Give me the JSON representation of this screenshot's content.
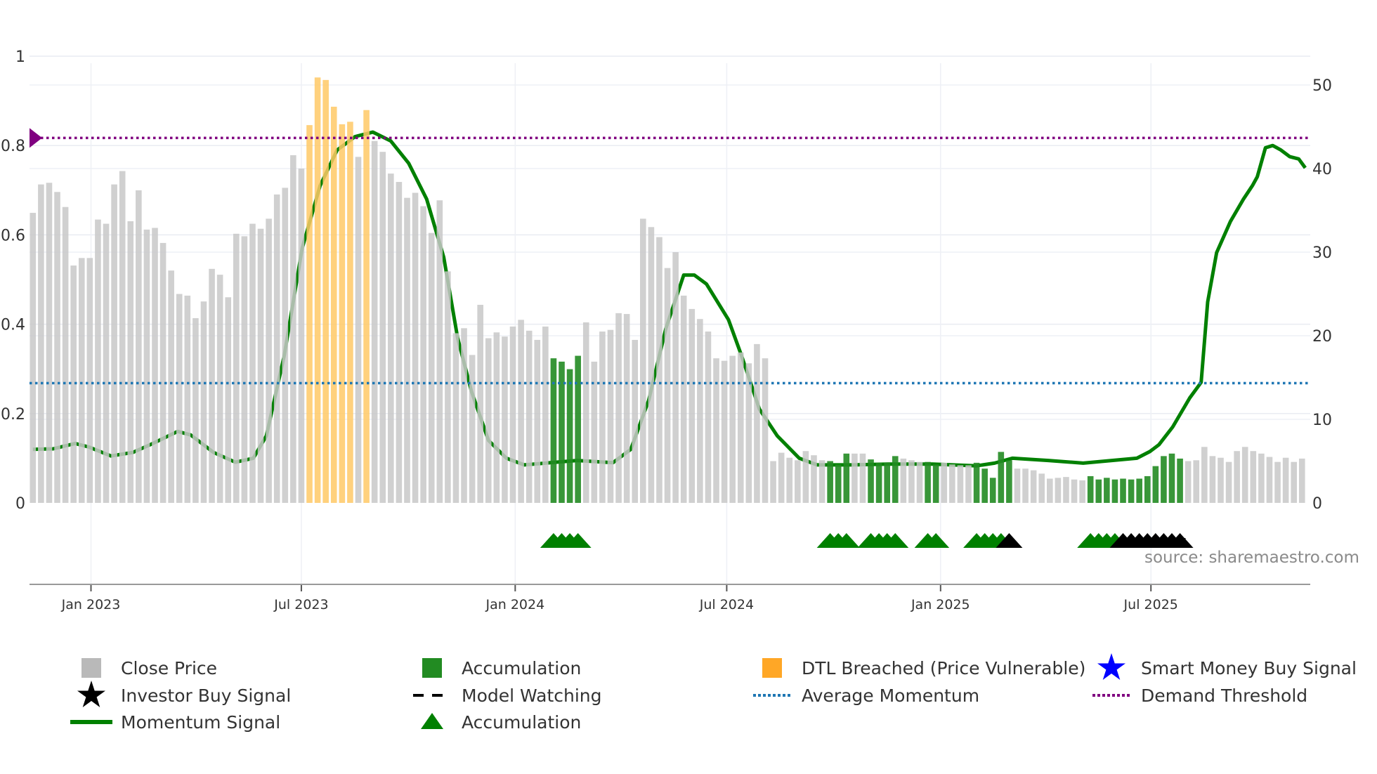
{
  "chart_data": {
    "type": "bar",
    "title": "",
    "start_date": "2022-11-12",
    "interval_days": 7,
    "left_axis": {
      "ylim": [
        0,
        1
      ],
      "ticks": [
        "0",
        "0.2",
        "0.4",
        "0.6",
        "0.8",
        "1"
      ]
    },
    "right_axis": {
      "ylim": [
        0,
        50
      ],
      "ticks": [
        "0",
        "10",
        "20",
        "30",
        "40",
        "50"
      ]
    },
    "x_ticks": [
      {
        "label": "Jan 2023",
        "date": "2023-01-01"
      },
      {
        "label": "Jul 2023",
        "date": "2023-07-01"
      },
      {
        "label": "Jan 2024",
        "date": "2024-01-01"
      },
      {
        "label": "Jul 2024",
        "date": "2024-07-01"
      },
      {
        "label": "Jan 2025",
        "date": "2025-01-01"
      },
      {
        "label": "Jul 2025",
        "date": "2025-07-01"
      }
    ],
    "close_price": [
      34.7,
      38.1,
      38.3,
      37.2,
      35.4,
      28.4,
      29.3,
      29.3,
      33.9,
      33.4,
      38.1,
      39.7,
      33.7,
      37.4,
      32.7,
      32.9,
      31.1,
      27.8,
      25.0,
      24.8,
      22.1,
      24.1,
      28.0,
      27.3,
      24.6,
      32.2,
      31.9,
      33.4,
      32.8,
      34.0,
      36.9,
      37.7,
      41.6,
      40.0,
      45.2,
      50.9,
      50.6,
      47.4,
      45.3,
      45.6,
      41.4,
      47.0,
      43.3,
      42.0,
      39.4,
      38.4,
      36.5,
      37.1,
      35.5,
      32.3,
      36.2,
      27.7,
      20.3,
      20.9,
      17.7,
      23.7,
      19.7,
      20.4,
      19.9,
      21.1,
      21.9,
      20.6,
      19.5,
      21.1,
      17.3,
      16.9,
      16.0,
      17.6,
      21.6,
      16.9,
      20.5,
      20.7,
      22.7,
      22.6,
      19.5,
      34.0,
      33.0,
      31.8,
      28.1,
      30.0,
      24.8,
      23.2,
      22.0,
      20.5,
      17.3,
      17.0,
      17.6,
      18.0,
      16.7,
      19.0,
      17.3,
      5.0,
      6.0,
      5.4,
      5.1,
      6.2,
      5.7,
      5.1,
      5.0,
      4.6,
      5.9,
      5.9,
      5.9,
      5.2,
      4.8,
      4.8,
      5.6,
      5.3,
      5.1,
      4.9,
      4.9,
      4.6,
      4.8,
      4.6,
      4.5,
      4.5,
      4.8,
      4.1,
      3.0,
      6.1,
      5.1,
      4.1,
      4.1,
      3.9,
      3.5,
      2.9,
      3.0,
      3.1,
      2.8,
      2.7,
      3.2,
      2.8,
      3.0,
      2.8,
      2.9,
      2.8,
      2.9,
      3.2,
      4.4,
      5.6,
      5.9,
      5.3,
      5.0,
      5.1,
      6.7,
      5.6,
      5.4,
      4.9,
      6.2,
      6.7,
      6.2,
      5.9,
      5.5,
      4.9,
      5.4,
      4.9,
      5.3
    ],
    "accumulation_bars": [
      64,
      65,
      66,
      67,
      98,
      99,
      100,
      103,
      104,
      105,
      106,
      110,
      111,
      116,
      117,
      118,
      119,
      120,
      130,
      131,
      132,
      133,
      134,
      135,
      136,
      137,
      138,
      139,
      140,
      141
    ],
    "dtl_breached_bars": [
      34,
      35,
      36,
      37,
      38,
      39,
      41
    ],
    "momentum_signal": [
      [
        0,
        0.12
      ],
      [
        2.5,
        0.121
      ],
      [
        5.2,
        0.133
      ],
      [
        6.9,
        0.125
      ],
      [
        9.6,
        0.105
      ],
      [
        12.3,
        0.113
      ],
      [
        14.5,
        0.131
      ],
      [
        17.8,
        0.16
      ],
      [
        19.4,
        0.152
      ],
      [
        22.2,
        0.113
      ],
      [
        24.9,
        0.091
      ],
      [
        27.1,
        0.1
      ],
      [
        28.7,
        0.15
      ],
      [
        30.9,
        0.33
      ],
      [
        33.1,
        0.57
      ],
      [
        35.3,
        0.71
      ],
      [
        37.4,
        0.79
      ],
      [
        39.6,
        0.82
      ],
      [
        41.8,
        0.83
      ],
      [
        44.0,
        0.81
      ],
      [
        46.2,
        0.76
      ],
      [
        48.4,
        0.68
      ],
      [
        50.5,
        0.55
      ],
      [
        52.2,
        0.37
      ],
      [
        53.9,
        0.25
      ],
      [
        56.0,
        0.14
      ],
      [
        58.2,
        0.1
      ],
      [
        60.4,
        0.085
      ],
      [
        63.6,
        0.09
      ],
      [
        66.9,
        0.095
      ],
      [
        71.3,
        0.09
      ],
      [
        73.5,
        0.12
      ],
      [
        75.7,
        0.23
      ],
      [
        77.8,
        0.39
      ],
      [
        80.0,
        0.51
      ],
      [
        81.3,
        0.51
      ],
      [
        82.8,
        0.49
      ],
      [
        85.5,
        0.41
      ],
      [
        87.1,
        0.33
      ],
      [
        89.3,
        0.21
      ],
      [
        91.5,
        0.15
      ],
      [
        94.2,
        0.1
      ],
      [
        96.4,
        0.085
      ],
      [
        100.8,
        0.085
      ],
      [
        105.1,
        0.087
      ],
      [
        110.6,
        0.087
      ],
      [
        116.0,
        0.083
      ],
      [
        118.2,
        0.089
      ],
      [
        120.4,
        0.1
      ],
      [
        124.8,
        0.095
      ],
      [
        129.1,
        0.089
      ],
      [
        135.7,
        0.1
      ],
      [
        137.3,
        0.115
      ],
      [
        138.4,
        0.13
      ],
      [
        140.1,
        0.17
      ],
      [
        142.2,
        0.235
      ],
      [
        143.6,
        0.27
      ],
      [
        144.4,
        0.45
      ],
      [
        145.5,
        0.56
      ],
      [
        147.2,
        0.63
      ],
      [
        148.8,
        0.68
      ],
      [
        149.9,
        0.71
      ],
      [
        150.5,
        0.73
      ],
      [
        151.5,
        0.795
      ],
      [
        152.4,
        0.8
      ],
      [
        153.4,
        0.79
      ],
      [
        154.5,
        0.775
      ],
      [
        155.6,
        0.77
      ],
      [
        156.4,
        0.75
      ]
    ],
    "average_momentum": 0.268,
    "demand_threshold": 0.817,
    "accumulation_triangles": [
      64,
      65,
      66,
      67,
      98,
      99,
      100,
      103,
      104,
      105,
      106,
      110,
      111,
      116,
      117,
      118,
      119,
      130,
      131,
      132,
      133
    ],
    "investor_buy_signals": [
      120,
      134,
      135,
      136,
      137,
      138,
      139,
      140,
      141
    ],
    "model_watching": [
      136,
      141
    ],
    "source": "source: sharemaestro.com",
    "legend": [
      {
        "label": "Close Price",
        "symbol": "square",
        "color": "#b9b9b9"
      },
      {
        "label": "Accumulation",
        "symbol": "square",
        "color": "#228b22"
      },
      {
        "label": "DTL Breached (Price Vulnerable)",
        "symbol": "square",
        "color": "#ffa726"
      },
      {
        "label": "Smart Money Buy Signal",
        "symbol": "star",
        "color": "#0000ff"
      },
      {
        "label": "Investor Buy Signal",
        "symbol": "star",
        "color": "#000000"
      },
      {
        "label": "Model Watching",
        "symbol": "dash",
        "color": "#000000"
      },
      {
        "label": "Average Momentum",
        "symbol": "dot",
        "color": "#1f77b4"
      },
      {
        "label": "Demand Threshold",
        "symbol": "dot",
        "color": "#800080"
      },
      {
        "label": "Momentum Signal",
        "symbol": "line",
        "color": "#008000"
      },
      {
        "label": "Accumulation",
        "symbol": "triangle",
        "color": "#008000"
      }
    ],
    "colors": {
      "gray": "#c8c8c8",
      "green": "#228b22",
      "orange": "#ffc966",
      "line": "#008000",
      "avg": "#1f77b4",
      "demand": "#800080"
    }
  }
}
